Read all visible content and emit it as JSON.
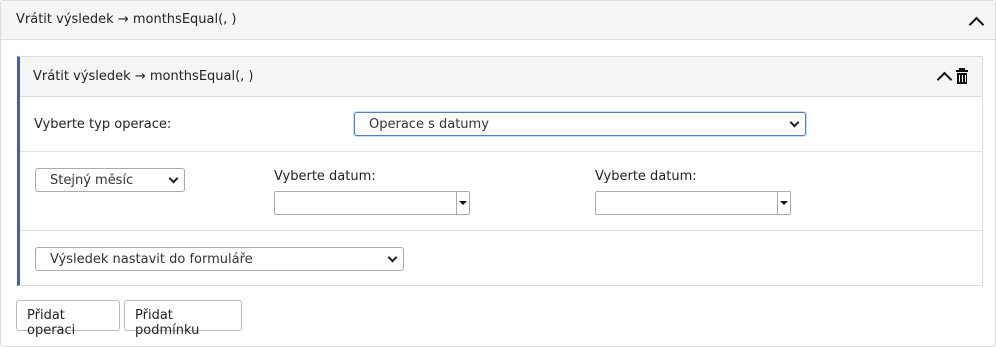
{
  "outer": {
    "title": "Vrátit výsledek → monthsEqual(, )"
  },
  "inner": {
    "title": "Vrátit výsledek → monthsEqual(, )"
  },
  "operation_type": {
    "label": "Vyberte typ operace:",
    "value": "Operace s datumy"
  },
  "comparison": {
    "value": "Stejný měsíc"
  },
  "date1": {
    "label": "Vyberte datum:",
    "value": ""
  },
  "date2": {
    "label": "Vyberte datum:",
    "value": ""
  },
  "result_target": {
    "value": "Výsledek nastavit do formuláře"
  },
  "buttons": {
    "add_operation": "Přidat operaci",
    "add_condition": "Přidat podmínku"
  },
  "icons": {
    "collapse": "chevron-up-icon",
    "delete": "trash-icon"
  },
  "colors": {
    "accent_border": "#4a5fa8",
    "focus": "#4a7fd8"
  }
}
